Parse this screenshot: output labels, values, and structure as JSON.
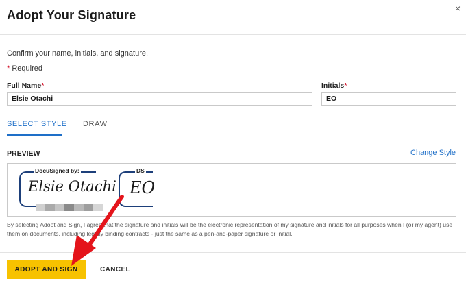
{
  "dialog": {
    "title": "Adopt Your Signature",
    "close_glyph": "×",
    "intro": "Confirm your name, initials, and signature.",
    "required_marker": "*",
    "required_note": "Required"
  },
  "form": {
    "full_name_label": "Full Name",
    "full_name_value": "Elsie Otachi",
    "initials_label": "Initials",
    "initials_value": "EO"
  },
  "tabs": [
    {
      "label": "SELECT STYLE",
      "active": true
    },
    {
      "label": "DRAW",
      "active": false
    }
  ],
  "preview": {
    "heading": "PREVIEW",
    "change_style": "Change Style",
    "signature_caption": "DocuSigned by:",
    "signature_text": "Elsie Otachi",
    "initials_caption": "DS",
    "initials_text": "EO"
  },
  "legal": "By selecting Adopt and Sign, I agree that the signature and initials will be the electronic representation of my signature and initials for all purposes when I (or my agent) use them on documents, including legally binding contracts - just the same as a pen-and-paper signature or initial.",
  "footer": {
    "adopt_button": "ADOPT AND SIGN",
    "cancel_button": "CANCEL"
  },
  "colors": {
    "accent": "#1e6fc8",
    "primary_button": "#f7c200",
    "annotation_arrow": "#e4141b",
    "signature_frame": "#1d3f7a"
  },
  "icons": {
    "close": "close-icon",
    "annotation": "red-arrow-icon"
  }
}
